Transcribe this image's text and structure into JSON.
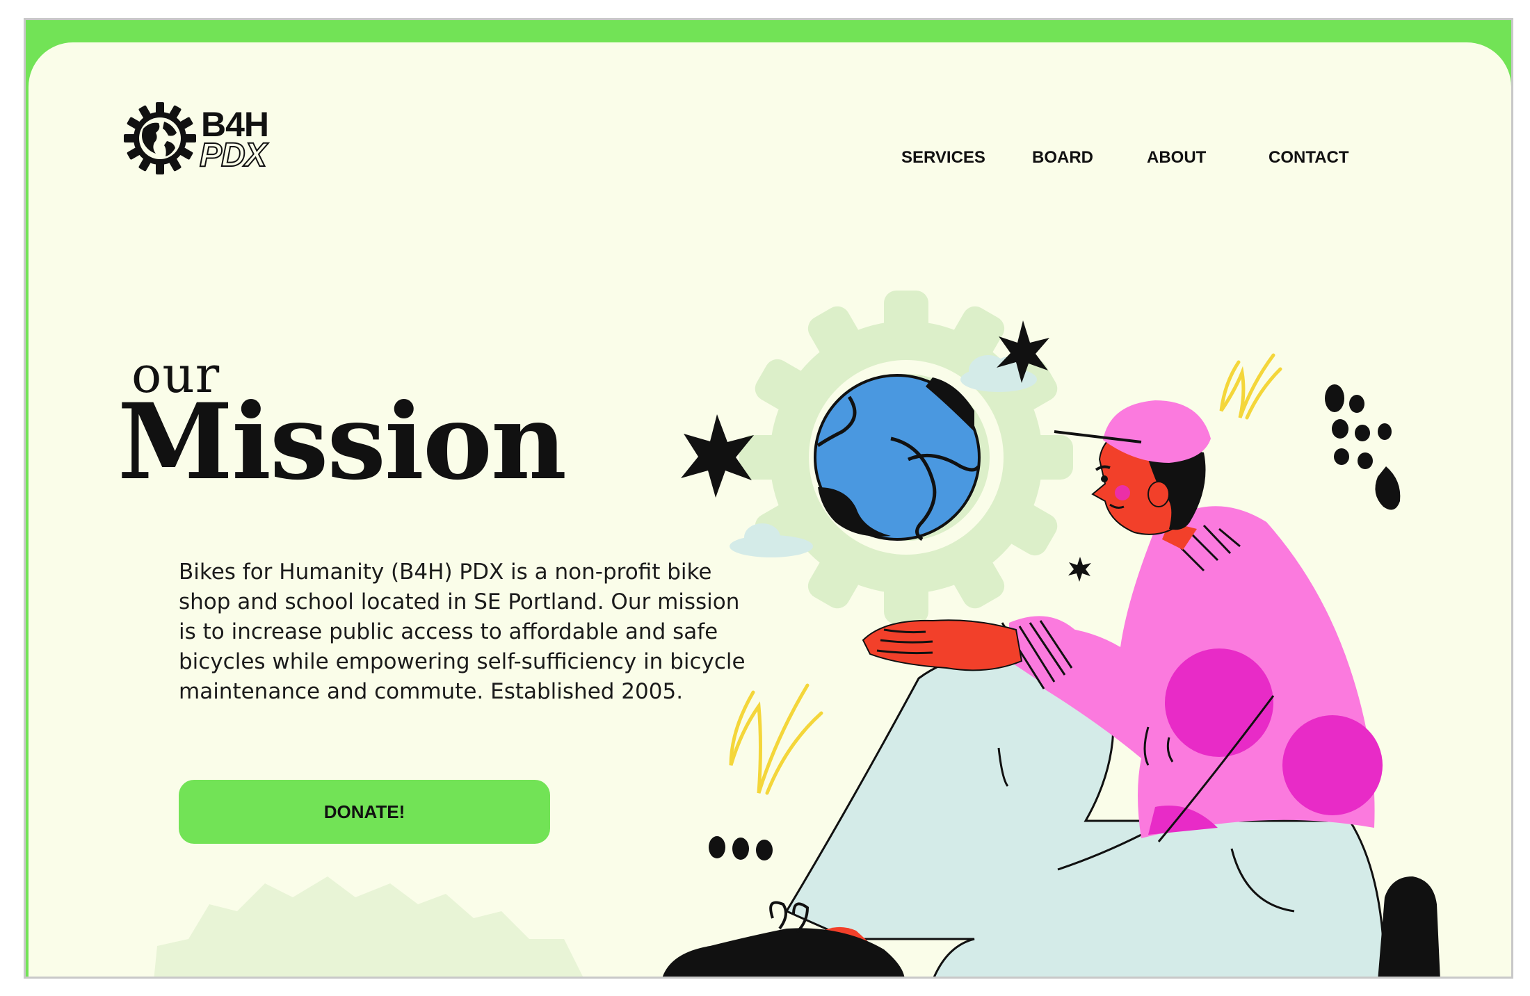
{
  "brand": {
    "logo_line1": "B4H",
    "logo_line2": "PDX",
    "accent_color": "#72e356",
    "page_background": "#fafde9"
  },
  "nav": {
    "items": [
      {
        "label": "SERVICES"
      },
      {
        "label": "BOARD"
      },
      {
        "label": "ABOUT"
      },
      {
        "label": "CONTACT"
      }
    ]
  },
  "hero": {
    "title_small": "our",
    "title_large": "Mission",
    "paragraph": "Bikes for Humanity (B4H) PDX is a non-profit bike shop and school located in SE Portland. Our mission is to increase public access to affordable and safe bicycles while empowering self-sufficiency in bicycle maintenance and commute. Established 2005.",
    "donate_label": "DONATE!"
  },
  "illustration": {
    "icons": [
      "gear-icon",
      "globe-icon",
      "star-icon",
      "cloud-icon",
      "scribble-icon",
      "dots-icon"
    ],
    "colors": {
      "globe_ocean": "#4a98e0",
      "skin": "#f2402a",
      "sweater": "#fb7ade",
      "sweater_spots": "#e82bc7",
      "pants": "#d4ebe8",
      "gear_light": "#dcefc9",
      "scribble": "#f4d63a"
    }
  }
}
